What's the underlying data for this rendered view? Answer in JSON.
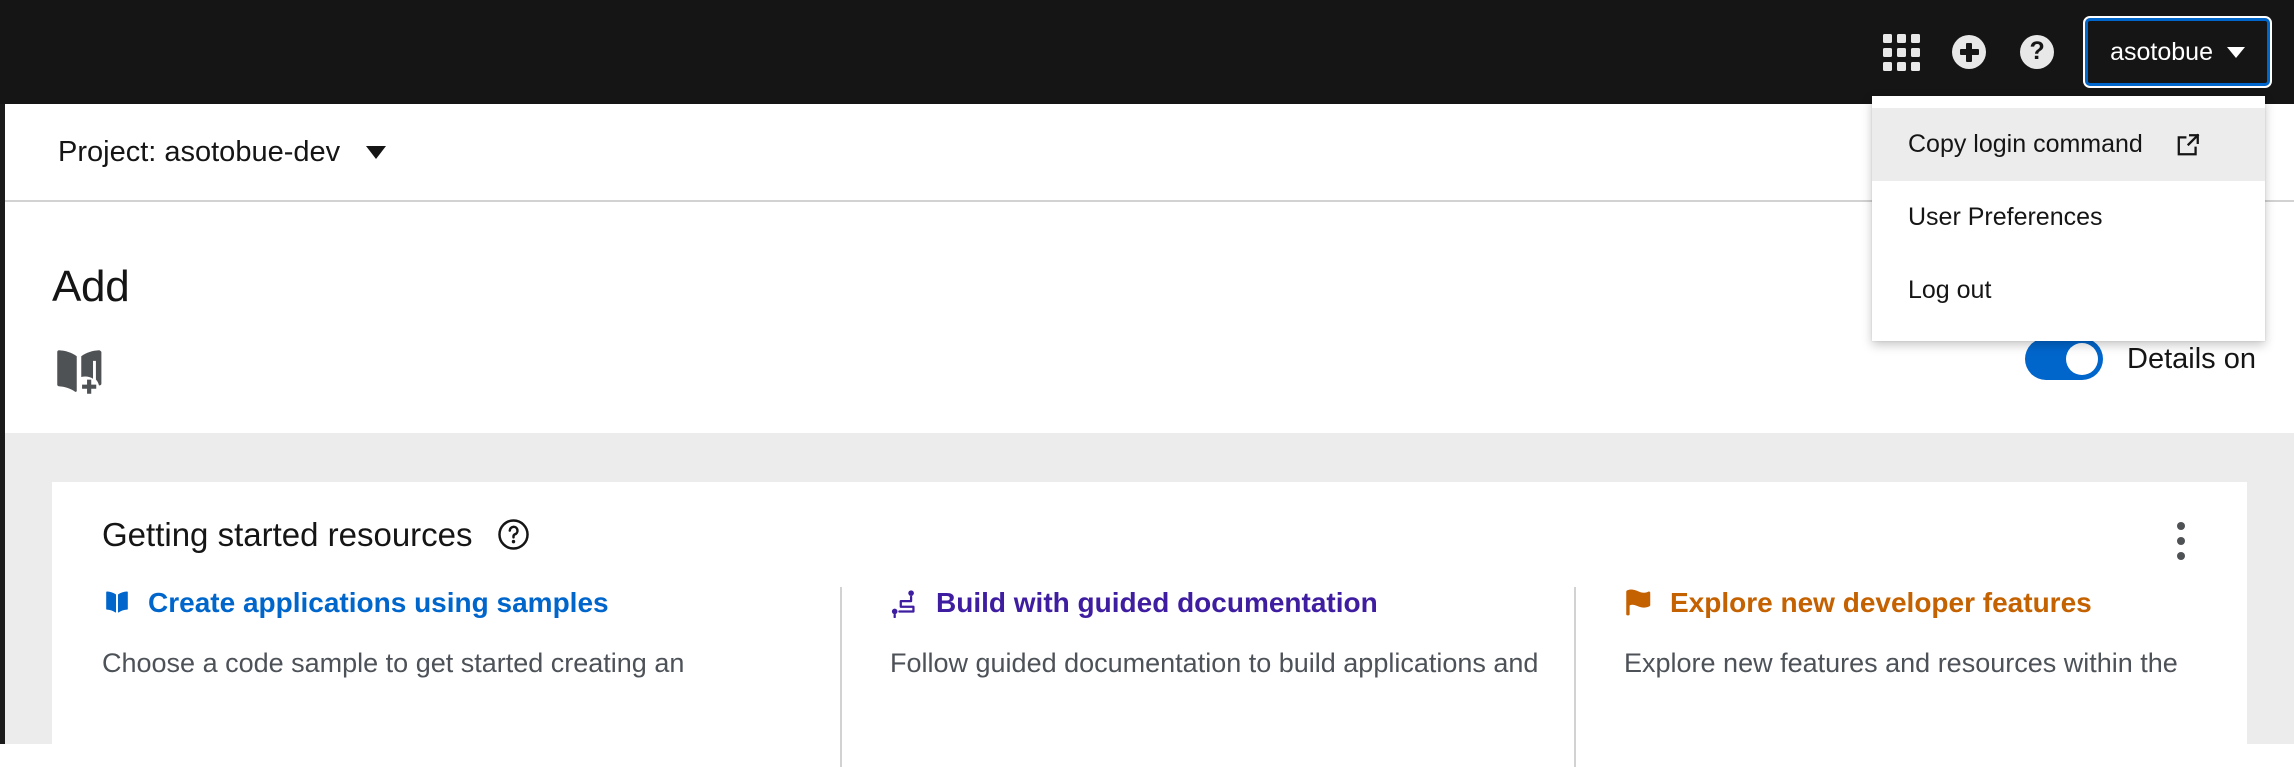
{
  "masthead": {
    "apps_icon": "grid-apps-icon",
    "add_icon": "plus-circle-icon",
    "help_icon": "question-circle-icon",
    "username": "asotobue",
    "focus_outline_color": "#0066cc",
    "background": "#151515"
  },
  "user_dropdown": {
    "items": [
      {
        "label": "Copy login command",
        "icon": "external-link-icon",
        "highlighted": true
      },
      {
        "label": "User Preferences",
        "icon": "",
        "highlighted": false
      },
      {
        "label": "Log out",
        "icon": "",
        "highlighted": false
      }
    ],
    "highlight_color": "#ececec"
  },
  "project_bar": {
    "label": "Project: asotobue-dev",
    "caret": "caret-down-icon"
  },
  "page_header": {
    "title": "Add",
    "icon": "book-plus-icon",
    "details_toggle": {
      "state": "on",
      "label": "Details on",
      "accent_color": "#0066cc"
    }
  },
  "getting_started": {
    "title": "Getting started resources",
    "help_icon": "question-circle-outline-icon",
    "kebab_icon": "kebab-vertical-icon",
    "columns": [
      {
        "icon": "book-icon",
        "link": "Create applications using samples",
        "color": "#0066cc",
        "description": "Choose a code sample to get started creating an"
      },
      {
        "icon": "route-icon",
        "link": "Build with guided documentation",
        "color": "#3e1da0",
        "description": "Follow guided documentation to build applications and"
      },
      {
        "icon": "flag-icon",
        "link": "Explore new developer features",
        "color": "#c46100",
        "description": "Explore new features and resources within the"
      }
    ]
  }
}
